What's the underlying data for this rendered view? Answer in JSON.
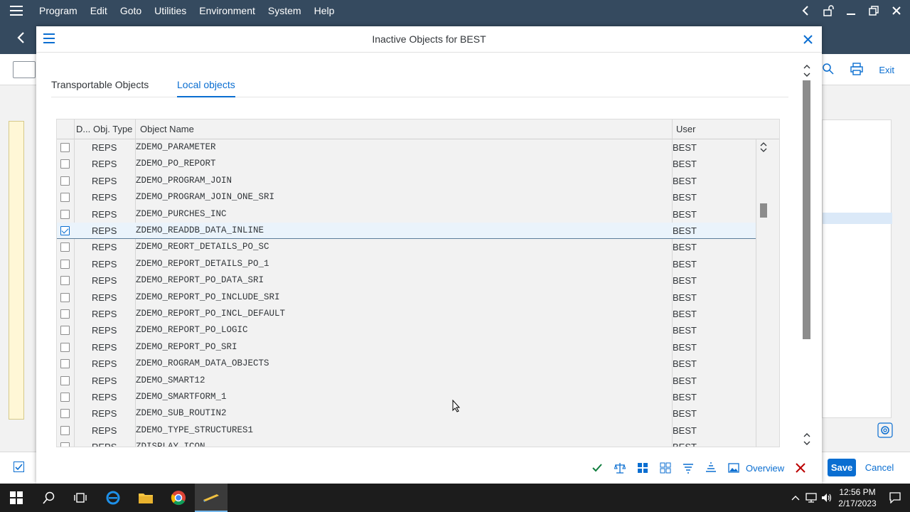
{
  "menubar": {
    "items": [
      "Program",
      "Edit",
      "Goto",
      "Utilities",
      "Environment",
      "System",
      "Help"
    ]
  },
  "background_toolbar": {
    "exit_label": "Exit"
  },
  "dialog": {
    "title": "Inactive Objects for BEST",
    "tabs": [
      "Transportable Objects",
      "Local objects"
    ],
    "active_tab": "Local objects",
    "table": {
      "columns": [
        "D...",
        "Obj. Type",
        "Object Name",
        "User"
      ],
      "rows": [
        {
          "checked": false,
          "type": "REPS",
          "name": "ZDEMO_PARAMETER",
          "user": "BEST"
        },
        {
          "checked": false,
          "type": "REPS",
          "name": "ZDEMO_PO_REPORT",
          "user": "BEST"
        },
        {
          "checked": false,
          "type": "REPS",
          "name": "ZDEMO_PROGRAM_JOIN",
          "user": "BEST"
        },
        {
          "checked": false,
          "type": "REPS",
          "name": "ZDEMO_PROGRAM_JOIN_ONE_SRI",
          "user": "BEST"
        },
        {
          "checked": false,
          "type": "REPS",
          "name": "ZDEMO_PURCHES_INC",
          "user": "BEST"
        },
        {
          "checked": true,
          "type": "REPS",
          "name": "ZDEMO_READDB_DATA_INLINE",
          "user": "BEST"
        },
        {
          "checked": false,
          "type": "REPS",
          "name": "ZDEMO_REORT_DETAILS_PO_SC",
          "user": "BEST"
        },
        {
          "checked": false,
          "type": "REPS",
          "name": "ZDEMO_REPORT_DETAILS_PO_1",
          "user": "BEST"
        },
        {
          "checked": false,
          "type": "REPS",
          "name": "ZDEMO_REPORT_PO_DATA_SRI",
          "user": "BEST"
        },
        {
          "checked": false,
          "type": "REPS",
          "name": "ZDEMO_REPORT_PO_INCLUDE_SRI",
          "user": "BEST"
        },
        {
          "checked": false,
          "type": "REPS",
          "name": "ZDEMO_REPORT_PO_INCL_DEFAULT",
          "user": "BEST"
        },
        {
          "checked": false,
          "type": "REPS",
          "name": "ZDEMO_REPORT_PO_LOGIC",
          "user": "BEST"
        },
        {
          "checked": false,
          "type": "REPS",
          "name": "ZDEMO_REPORT_PO_SRI",
          "user": "BEST"
        },
        {
          "checked": false,
          "type": "REPS",
          "name": "ZDEMO_ROGRAM_DATA_OBJECTS",
          "user": "BEST"
        },
        {
          "checked": false,
          "type": "REPS",
          "name": "ZDEMO_SMART12",
          "user": "BEST"
        },
        {
          "checked": false,
          "type": "REPS",
          "name": "ZDEMO_SMARTFORM_1",
          "user": "BEST"
        },
        {
          "checked": false,
          "type": "REPS",
          "name": "ZDEMO_SUB_ROUTIN2",
          "user": "BEST"
        },
        {
          "checked": false,
          "type": "REPS",
          "name": "ZDEMO_TYPE_STRUCTURES1",
          "user": "BEST"
        },
        {
          "checked": false,
          "type": "REPS",
          "name": "ZDISPLAY_ICON",
          "user": "BEST"
        }
      ]
    },
    "footer": {
      "overview_label": "Overview"
    }
  },
  "bottombar": {
    "save_label": "Save",
    "cancel_label": "Cancel"
  },
  "taskbar": {
    "time": "12:56 PM",
    "date": "2/17/2023"
  },
  "colors": {
    "shell": "#354a5f",
    "accent": "#0a6ed1",
    "reject": "#bb0000",
    "accept": "#107e3e"
  }
}
